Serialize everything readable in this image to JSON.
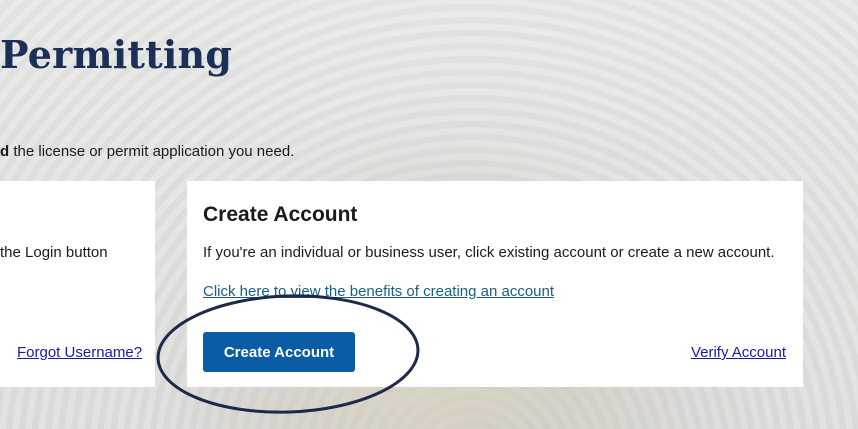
{
  "page": {
    "title": "Permitting",
    "instruction_bold": "d",
    "instruction_rest": " the license or permit application you need."
  },
  "login_card": {
    "text": "the Login button",
    "forgot_username_label": "Forgot Username?"
  },
  "create_card": {
    "heading": "Create Account",
    "description": "If you're an individual or business user, click existing account or create a new account.",
    "benefits_link": "Click here to view the benefits of creating an account",
    "create_button_label": "Create Account",
    "verify_link": "Verify Account"
  },
  "colors": {
    "title": "#1c2f57",
    "primary_button": "#0b5ca5",
    "annotation_ellipse": "#1c2a4a"
  }
}
